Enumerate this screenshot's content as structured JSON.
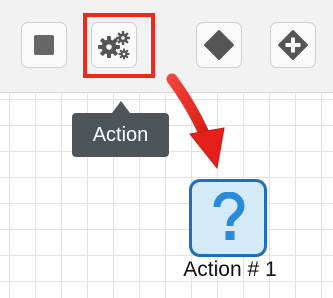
{
  "toolbar": {
    "buttons": [
      {
        "icon": "square-icon",
        "tooltip": ""
      },
      {
        "icon": "gears-icon",
        "tooltip": "Action"
      },
      {
        "icon": "diamond-icon",
        "tooltip": ""
      },
      {
        "icon": "diamond-plus-icon",
        "tooltip": ""
      }
    ],
    "active_tooltip": "Action"
  },
  "canvas": {
    "node": {
      "icon": "question-mark-icon",
      "glyph": "?",
      "label": "Action # 1"
    }
  },
  "colors": {
    "highlight": "#f0291a",
    "arrow": "#e5201a",
    "tooltip_bg": "#4e5559",
    "node_border": "#1b6fc2",
    "node_fill": "#d5eaf8",
    "question_mark": "#2a8bd8"
  }
}
